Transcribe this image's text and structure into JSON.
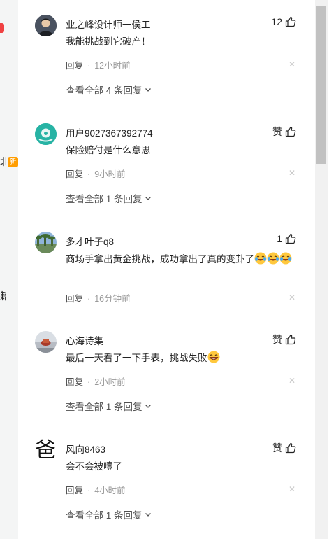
{
  "left_column": {
    "chars": [
      "北",
      "籍"
    ],
    "new_badge": "新"
  },
  "comments": [
    {
      "username": "业之峰设计师一侯工",
      "likes": "12",
      "content": "我能挑战到它破产！",
      "reply_label": "回复",
      "time": "12小时前",
      "view_replies": "查看全部 4 条回复"
    },
    {
      "username": "用户9027367392774",
      "likes": "赞",
      "content": "保险赔付是什么意思",
      "reply_label": "回复",
      "time": "9小时前",
      "view_replies": "查看全部 1 条回复"
    },
    {
      "username": "多才叶子q8",
      "likes": "1",
      "content": "商场手拿出黄金挑战，成功拿出了真的变卦了",
      "reply_label": "回复",
      "time": "16分钟前"
    },
    {
      "username": "心海诗集",
      "likes": "赞",
      "content": "最后一天看了一下手表，挑战失败",
      "reply_label": "回复",
      "time": "2小时前",
      "view_replies": "查看全部 1 条回复"
    },
    {
      "username": "风向8463",
      "likes": "赞",
      "avatar_char": "爸",
      "content": "会不会被噎了",
      "reply_label": "回复",
      "time": "4小时前",
      "view_replies": "查看全部 1 条回复"
    }
  ],
  "icons": {
    "like": "thumbs-up-icon",
    "close": "close-icon",
    "chevron": "chevron-down-icon",
    "emoji_cry": "crying-laughing-emoji",
    "emoji_grin": "grinning-emoji"
  }
}
